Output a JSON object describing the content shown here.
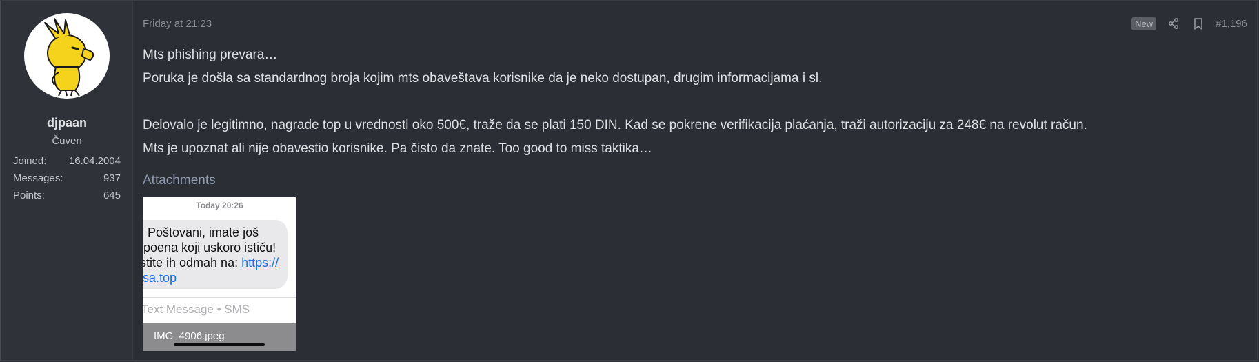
{
  "user": {
    "avatar_icon": "woodstock-avatar-icon",
    "name": "djpaan",
    "title": "Čuven",
    "stats": [
      {
        "label": "Joined:",
        "value": "16.04.2004"
      },
      {
        "label": "Messages:",
        "value": "937"
      },
      {
        "label": "Points:",
        "value": "645"
      }
    ]
  },
  "post": {
    "date": "Friday at 21:23",
    "badge": "New",
    "share_icon": "share-icon",
    "bookmark_icon": "bookmark-icon",
    "number": "#1,196",
    "lines": [
      "Mts phishing prevara…",
      "Poruka je došla sa standardnog broja kojim mts obaveštava korisnike da je neko dostupan, drugim informacijama i sl.",
      "",
      "Delovalo je legitimno, nagrade top u vrednosti oko 500€, traže da se plati 150 DIN. Kad se pokrene verifikacija plaćanja, traži autorizaciju za 248€ na revolut račun.",
      "Mts je upoznat ali nije obavestio korisnike. Pa čisto da znate. Too good to miss taktika…"
    ],
    "attachments_label": "Attachments",
    "attachment": {
      "sms_time": "Today 20:26",
      "sms_line1": "Poštovani, imate još",
      "sms_line2": "poena koji uskoro ističu!",
      "sms_line3_prefix": "stite ih odmah na: ",
      "sms_line3_link": "https://",
      "sms_line4_link": "sa.top",
      "sms_input": "Text Message • SMS",
      "filename": "IMG_4906.jpeg"
    }
  },
  "colors": {
    "background": "#2b2e34",
    "user_panel": "#2f3238",
    "attachments_label": "#8f9bb0"
  }
}
